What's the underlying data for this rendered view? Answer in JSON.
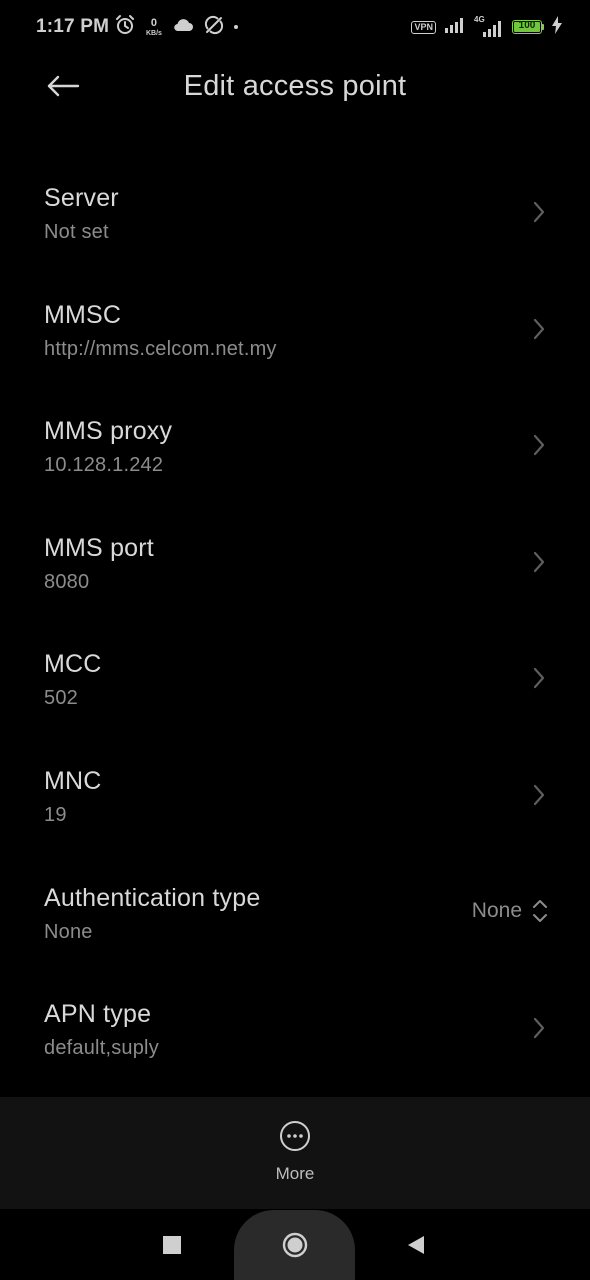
{
  "status_bar": {
    "time": "1:17 PM",
    "speed_value": "0",
    "speed_unit": "KB/s",
    "vpn_label": "VPN",
    "network_label": "4G",
    "battery_level": "100",
    "battery_color": "#73c43f",
    "icons": [
      "alarm-icon",
      "cloud-icon",
      "no-sync-icon",
      "signal-icon",
      "signal-4g-icon",
      "charging-icon"
    ]
  },
  "header": {
    "title": "Edit access point",
    "back_icon": "arrow-left-icon"
  },
  "settings": [
    {
      "title": "Server",
      "value": "Not set",
      "control": "chevron"
    },
    {
      "title": "MMSC",
      "value": "http://mms.celcom.net.my",
      "control": "chevron"
    },
    {
      "title": "MMS proxy",
      "value": "10.128.1.242",
      "control": "chevron"
    },
    {
      "title": "MMS port",
      "value": "8080",
      "control": "chevron"
    },
    {
      "title": "MCC",
      "value": "502",
      "control": "chevron"
    },
    {
      "title": "MNC",
      "value": "19",
      "control": "chevron"
    },
    {
      "title": "Authentication type",
      "value": "None",
      "control": "select",
      "selected": "None"
    },
    {
      "title": "APN type",
      "value": "default,suply",
      "control": "chevron"
    }
  ],
  "action_bar": {
    "more_label": "More",
    "more_icon": "more-horizontal-icon"
  },
  "nav_bar": {
    "icons": [
      "recents-square-icon",
      "home-circle-icon",
      "back-triangle-icon"
    ]
  }
}
